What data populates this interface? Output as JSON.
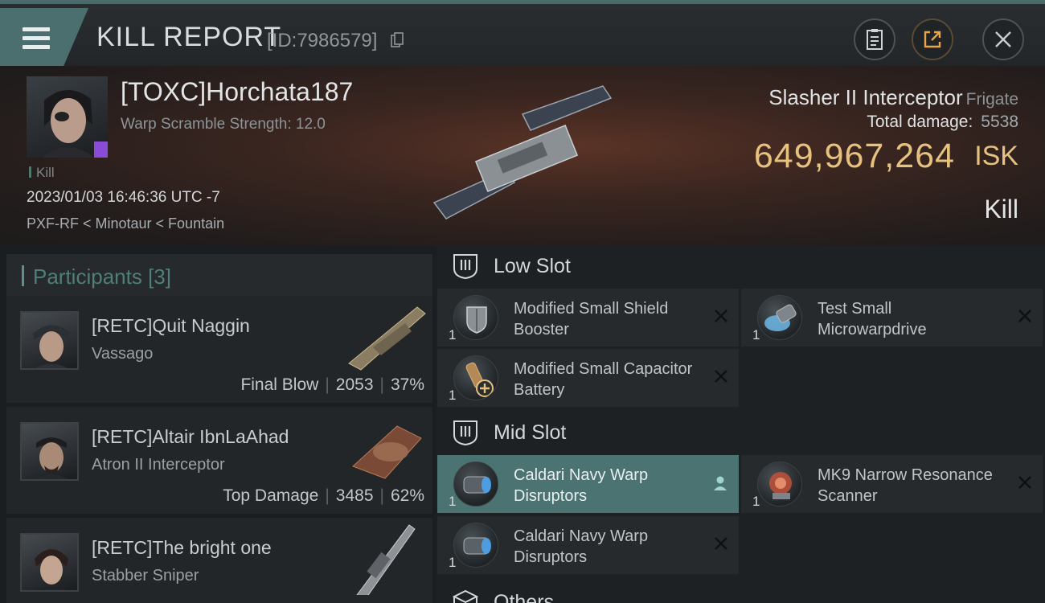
{
  "header": {
    "title": "KILL REPORT",
    "id_text": "[ID:7986579]",
    "icons": [
      "menu-icon",
      "copy-icon",
      "clipboard-icon",
      "share-icon",
      "close-icon"
    ]
  },
  "victim": {
    "name": "[TOXC]Horchata187",
    "subtitle": "Warp Scramble Strength: 12.0",
    "tag": "Kill",
    "datetime": "2023/01/03 16:46:36 UTC -7",
    "location": "PXF-RF < Minotaur < Fountain",
    "ship_name": "Slasher II Interceptor",
    "ship_class": "Frigate",
    "total_damage_label": "Total damage:",
    "total_damage_value": "5538",
    "isk_value": "649,967,264",
    "isk_label": "ISK",
    "result": "Kill"
  },
  "participants": {
    "title": "Participants [3]",
    "rows": [
      {
        "name": "[RETC]Quit Naggin",
        "ship": "Vassago",
        "role": "Final Blow",
        "damage": "2053",
        "percent": "37%"
      },
      {
        "name": "[RETC]Altair IbnLaAhad",
        "ship": "Atron II Interceptor",
        "role": "Top Damage",
        "damage": "3485",
        "percent": "62%"
      },
      {
        "name": "[RETC]The bright one",
        "ship": "Stabber Sniper",
        "role": "",
        "damage": "",
        "percent": ""
      }
    ]
  },
  "slots": {
    "low": {
      "title": "Low Slot",
      "items": [
        {
          "name": "Modified Small Shield Booster",
          "qty": "1"
        },
        {
          "name": "Test Small Microwarpdrive",
          "qty": "1"
        },
        {
          "name": "Modified Small Capacitor Battery",
          "qty": "1"
        }
      ]
    },
    "mid": {
      "title": "Mid Slot",
      "items": [
        {
          "name": "Caldari Navy Warp Disruptors",
          "qty": "1"
        },
        {
          "name": "MK9 Narrow Resonance Scanner",
          "qty": "1"
        },
        {
          "name": "Caldari Navy Warp Disruptors",
          "qty": "1"
        }
      ]
    },
    "others": {
      "title": "Others"
    }
  },
  "colors": {
    "accent_teal": "#4b7371",
    "isk_gold": "#e6c27e",
    "implant_purple": "#8a4bd6"
  }
}
